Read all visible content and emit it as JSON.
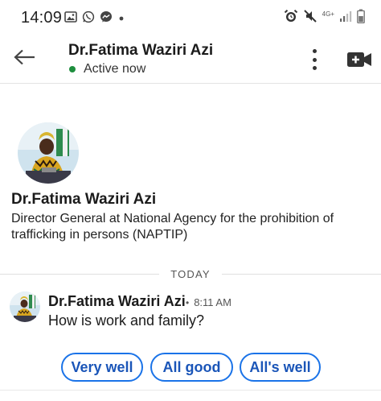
{
  "status_bar": {
    "time": "14:09",
    "left_icons": [
      "gallery-icon",
      "whatsapp-icon",
      "messenger-icon",
      "dot-icon"
    ],
    "right_icons": [
      "alarm-icon",
      "mute-icon",
      "signal-icon",
      "battery-icon"
    ],
    "network": "4G+"
  },
  "header": {
    "back_icon": "arrow-left-icon",
    "contact_name": "Dr.Fatima Waziri Azi",
    "presence": "Active now",
    "presence_color": "#1e8e3e",
    "more_icon": "more-vert-icon",
    "video_icon": "video-call-add-icon"
  },
  "profile": {
    "name": "Dr.Fatima Waziri Azi",
    "bio": "Director General at National Agency for the prohibition of trafficking in persons (NAPTIP)"
  },
  "divider": {
    "label": "TODAY"
  },
  "message": {
    "sender": "Dr.Fatima Waziri Azi",
    "separator": "•",
    "time": "8:11 AM",
    "text": "How is work and family?"
  },
  "quick_replies": [
    "Very well",
    "All good",
    "All's well"
  ],
  "colors": {
    "accent": "#1a73e8",
    "chip_text": "#1a55b8",
    "presence": "#1e8e3e"
  }
}
